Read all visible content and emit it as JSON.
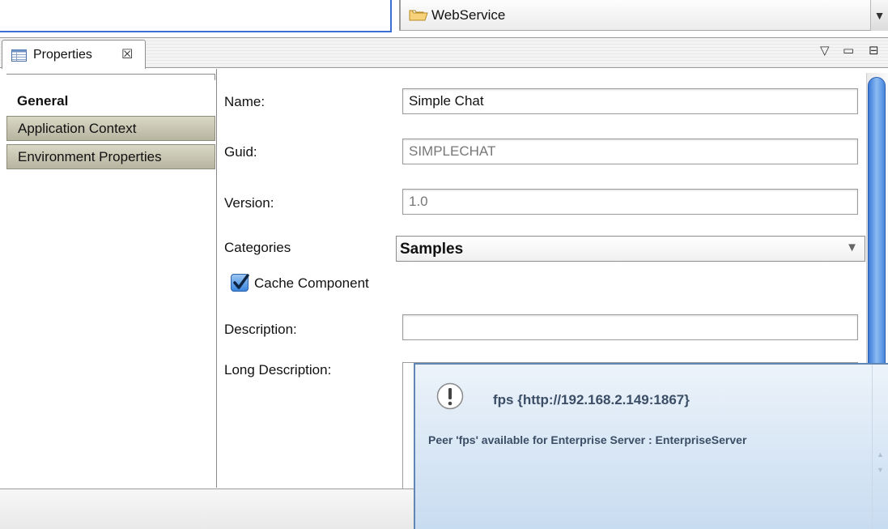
{
  "toolbar": {
    "combo_value": "WebService",
    "combo_arrow": "▼"
  },
  "view": {
    "tab_label": "Properties",
    "tab_close_glyph": "☒",
    "menu_glyph": "▽",
    "minimize_glyph": "▭",
    "maximize_glyph": "⊟"
  },
  "sections": [
    {
      "label": "General",
      "selected": true
    },
    {
      "label": "Application Context",
      "selected": false
    },
    {
      "label": "Environment Properties",
      "selected": false
    }
  ],
  "form": {
    "name_label": "Name:",
    "name_value": "Simple Chat",
    "guid_label": "Guid:",
    "guid_value": "SIMPLECHAT",
    "version_label": "Version:",
    "version_value": "1.0",
    "categories_label": "Categories",
    "categories_value": "Samples",
    "categories_arrow": "▼",
    "cache_label": "Cache Component",
    "cache_checked": true,
    "description_label": "Description:",
    "description_value": "",
    "long_description_label": "Long Description:"
  },
  "notification": {
    "icon": "exclamation-icon",
    "title": "fps  {http://192.168.2.149:1867}",
    "body": "Peer 'fps' available for Enterprise Server : EnterpriseServer"
  },
  "colors": {
    "accent_blue": "#3b6ed1",
    "section_tab_bg": "#c8c6b2",
    "notification_bg": "#d9e7f5",
    "notification_text": "#3c4e66"
  }
}
